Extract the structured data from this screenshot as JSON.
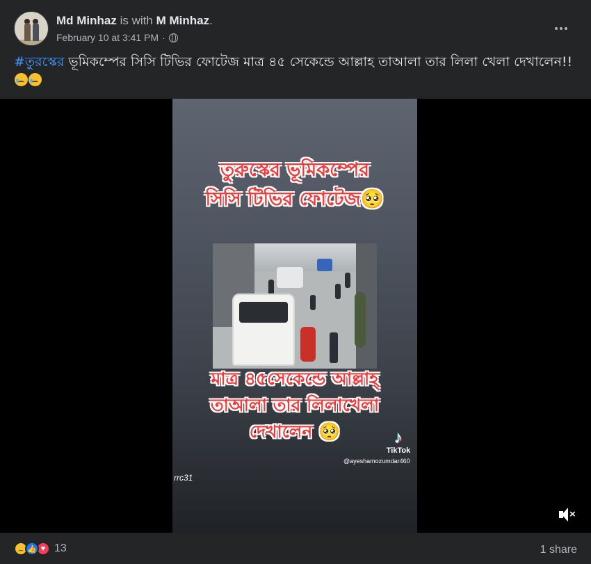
{
  "post": {
    "author_name": "Md Minhaz",
    "with_text": "is with",
    "tagged_name": "M Minhaz",
    "tagged_suffix": ".",
    "timestamp": "February 10 at 3:41 PM",
    "separator": "·",
    "privacy_icon": "globe-icon",
    "caption_hashtag": "#তুরস্কের",
    "caption_text": " ভূমিকম্পের সিসি টিভির ফোটেজ মাত্র ৪৫ সেকেন্ডে আল্লাহ তাআলা তার লিলা খেলা দেখালেন!!"
  },
  "video": {
    "title_line1": "তুরুস্কের ভূমিকম্পের",
    "title_line2": "সিসি টিভির ফোটেজ🥺",
    "bottom_line1": "মাত্র ৪৫সেকেন্ডে আল্লাহ্",
    "bottom_line2": "তাআলা তার লিলাখেলা",
    "bottom_line3": "দেখালেন 🥺",
    "tiktok_label": "TikTok",
    "tiktok_handle": "@ayeshamozumdar460",
    "watermark": "rrc31",
    "mute_icon": "muted-speaker-icon"
  },
  "footer": {
    "reaction_icons": [
      "sad-reaction-icon",
      "like-reaction-icon",
      "love-reaction-icon"
    ],
    "reaction_count": "13",
    "share_text": "1 share"
  },
  "colors": {
    "background": "#242526",
    "text_primary": "#e4e6eb",
    "text_secondary": "#b0b3b8",
    "hashtag": "#4599ff",
    "overlay_red": "#f23a3a"
  }
}
